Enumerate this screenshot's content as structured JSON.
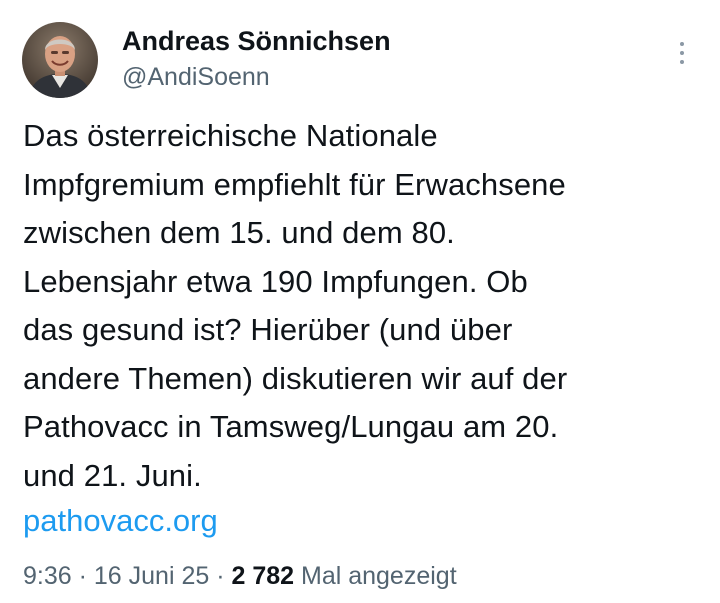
{
  "author": {
    "display_name": "Andreas Sönnichsen",
    "handle": "@AndiSoenn"
  },
  "tweet": {
    "lines": [
      "Das österreichische Nationale",
      "Impfgremium empfiehlt für Erwachsene",
      "zwischen dem 15. und dem 80.",
      "Lebensjahr etwa 190 Impfungen. Ob",
      "das gesund ist? Hierüber (und über",
      "andere Themen) diskutieren wir auf der",
      "Pathovacc in Tamsweg/Lungau am 20.",
      "und 21. Juni."
    ],
    "link": "pathovacc.org"
  },
  "meta": {
    "time": "9:36",
    "separator": " · ",
    "date": "16 Juni 25",
    "views_count": "2 782",
    "views_label": " Mal angezeigt"
  },
  "icons": {
    "avatar": "profile-photo",
    "more": "more-vertical-icon"
  },
  "colors": {
    "text": "#0f1419",
    "secondary": "#536471",
    "link": "#1d9bf0"
  }
}
